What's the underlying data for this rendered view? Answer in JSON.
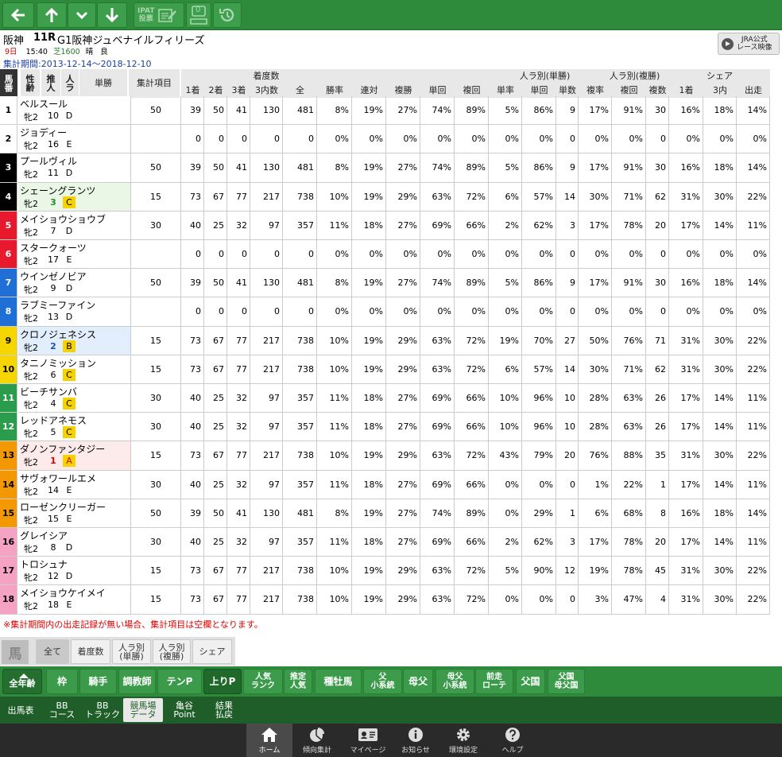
{
  "toolbar": {
    "ipat_label_top": "IPAT",
    "ipat_label_bottom": "投票",
    "memo_badge": "0"
  },
  "race": {
    "venue": "阪神",
    "race_no": "11R",
    "name": "G1阪神ジュベナイルフィリーズ",
    "day": "9日",
    "time": "15:40",
    "course": "芝1600",
    "weather": "晴",
    "going": "良",
    "period": "集計期間:2013-12-14～2018-12-10"
  },
  "jra_button": {
    "line1": "JRA公式",
    "line2": "レース映像"
  },
  "table": {
    "header_top": {
      "chaku": "着度数",
      "ninki_win": "人ラ別(単勝)",
      "ninki_place": "人ラ別(複勝)",
      "share": "シェア"
    },
    "header_left": {
      "umaban_1": "馬",
      "umaban_2": "番",
      "sex_1": "性",
      "sex_2": "齢",
      "est_1": "推",
      "est_2": "人",
      "pop_1": "人",
      "pop_2": "ラ",
      "odds": "単勝",
      "item": "集計項目"
    },
    "columns": [
      "1着",
      "2着",
      "3着",
      "3内数",
      "全",
      "勝率",
      "連対",
      "複勝",
      "単回",
      "複回",
      "単率",
      "単回",
      "単数",
      "複率",
      "複回",
      "複数",
      "1着",
      "3内",
      "出走"
    ],
    "rows": [
      {
        "no": "1",
        "name": "ベルスール",
        "sex": "牝2",
        "pop": "10",
        "mark": "D",
        "item": "50",
        "v": [
          "39",
          "50",
          "41",
          "130",
          "481",
          "8%",
          "19%",
          "27%",
          "74%",
          "89%",
          "5%",
          "86%",
          "9",
          "17%",
          "91%",
          "30",
          "16%",
          "18%",
          "14%"
        ]
      },
      {
        "no": "2",
        "name": "ジョディー",
        "sex": "牝2",
        "pop": "16",
        "mark": "E",
        "item": "",
        "v": [
          "0",
          "0",
          "0",
          "0",
          "0",
          "0%",
          "0%",
          "0%",
          "0%",
          "0%",
          "0%",
          "0%",
          "0",
          "0%",
          "0%",
          "0",
          "0%",
          "0%",
          "0%"
        ]
      },
      {
        "no": "3",
        "name": "プールヴィル",
        "sex": "牝2",
        "pop": "11",
        "mark": "D",
        "item": "50",
        "v": [
          "39",
          "50",
          "41",
          "130",
          "481",
          "8%",
          "19%",
          "27%",
          "74%",
          "89%",
          "5%",
          "86%",
          "9",
          "17%",
          "91%",
          "30",
          "16%",
          "18%",
          "14%"
        ]
      },
      {
        "no": "4",
        "name": "シェーングランツ",
        "sex": "牝2",
        "pop": "3",
        "mark": "C",
        "item": "15",
        "v": [
          "73",
          "67",
          "77",
          "217",
          "738",
          "10%",
          "19%",
          "29%",
          "63%",
          "72%",
          "6%",
          "57%",
          "14",
          "30%",
          "71%",
          "62",
          "31%",
          "30%",
          "22%"
        ]
      },
      {
        "no": "5",
        "name": "メイショウショウブ",
        "sex": "牝2",
        "pop": "7",
        "mark": "D",
        "item": "30",
        "v": [
          "40",
          "25",
          "32",
          "97",
          "357",
          "11%",
          "18%",
          "27%",
          "69%",
          "66%",
          "2%",
          "62%",
          "3",
          "17%",
          "78%",
          "20",
          "17%",
          "14%",
          "11%"
        ]
      },
      {
        "no": "6",
        "name": "スタークォーツ",
        "sex": "牝2",
        "pop": "17",
        "mark": "E",
        "item": "",
        "v": [
          "0",
          "0",
          "0",
          "0",
          "0",
          "0%",
          "0%",
          "0%",
          "0%",
          "0%",
          "0%",
          "0%",
          "0",
          "0%",
          "0%",
          "0",
          "0%",
          "0%",
          "0%"
        ]
      },
      {
        "no": "7",
        "name": "ウインゼノビア",
        "sex": "牝2",
        "pop": "9",
        "mark": "D",
        "item": "50",
        "v": [
          "39",
          "50",
          "41",
          "130",
          "481",
          "8%",
          "19%",
          "27%",
          "74%",
          "89%",
          "5%",
          "86%",
          "9",
          "17%",
          "91%",
          "30",
          "16%",
          "18%",
          "14%"
        ]
      },
      {
        "no": "8",
        "name": "ラブミーファイン",
        "sex": "牝2",
        "pop": "13",
        "mark": "D",
        "item": "",
        "v": [
          "0",
          "0",
          "0",
          "0",
          "0",
          "0%",
          "0%",
          "0%",
          "0%",
          "0%",
          "0%",
          "0%",
          "0",
          "0%",
          "0%",
          "0",
          "0%",
          "0%",
          "0%"
        ]
      },
      {
        "no": "9",
        "name": "クロノジェネシス",
        "sex": "牝2",
        "pop": "2",
        "mark": "B",
        "item": "15",
        "v": [
          "73",
          "67",
          "77",
          "217",
          "738",
          "10%",
          "19%",
          "29%",
          "63%",
          "72%",
          "19%",
          "70%",
          "27",
          "50%",
          "76%",
          "71",
          "31%",
          "30%",
          "22%"
        ]
      },
      {
        "no": "10",
        "name": "タニノミッション",
        "sex": "牝2",
        "pop": "6",
        "mark": "C",
        "item": "15",
        "v": [
          "73",
          "67",
          "77",
          "217",
          "738",
          "10%",
          "19%",
          "29%",
          "63%",
          "72%",
          "6%",
          "57%",
          "14",
          "30%",
          "71%",
          "62",
          "31%",
          "30%",
          "22%"
        ]
      },
      {
        "no": "11",
        "name": "ビーチサンバ",
        "sex": "牝2",
        "pop": "4",
        "mark": "C",
        "item": "30",
        "v": [
          "40",
          "25",
          "32",
          "97",
          "357",
          "11%",
          "18%",
          "27%",
          "69%",
          "66%",
          "10%",
          "96%",
          "10",
          "28%",
          "63%",
          "26",
          "17%",
          "14%",
          "11%"
        ]
      },
      {
        "no": "12",
        "name": "レッドアネモス",
        "sex": "牝2",
        "pop": "5",
        "mark": "C",
        "item": "30",
        "v": [
          "40",
          "25",
          "32",
          "97",
          "357",
          "11%",
          "18%",
          "27%",
          "69%",
          "66%",
          "10%",
          "96%",
          "10",
          "28%",
          "63%",
          "26",
          "17%",
          "14%",
          "11%"
        ]
      },
      {
        "no": "13",
        "name": "ダノンファンタジー",
        "sex": "牝2",
        "pop": "1",
        "mark": "A",
        "item": "15",
        "v": [
          "73",
          "67",
          "77",
          "217",
          "738",
          "10%",
          "19%",
          "29%",
          "63%",
          "72%",
          "43%",
          "79%",
          "20",
          "76%",
          "88%",
          "35",
          "31%",
          "30%",
          "22%"
        ]
      },
      {
        "no": "14",
        "name": "サヴォワールエメ",
        "sex": "牝2",
        "pop": "14",
        "mark": "E",
        "item": "30",
        "v": [
          "40",
          "25",
          "32",
          "97",
          "357",
          "11%",
          "18%",
          "27%",
          "69%",
          "66%",
          "0%",
          "0%",
          "0",
          "1%",
          "22%",
          "1",
          "17%",
          "14%",
          "11%"
        ]
      },
      {
        "no": "15",
        "name": "ローゼンクリーガー",
        "sex": "牝2",
        "pop": "15",
        "mark": "E",
        "item": "50",
        "v": [
          "39",
          "50",
          "41",
          "130",
          "481",
          "8%",
          "19%",
          "27%",
          "74%",
          "89%",
          "0%",
          "29%",
          "1",
          "6%",
          "68%",
          "8",
          "16%",
          "18%",
          "14%"
        ]
      },
      {
        "no": "16",
        "name": "グレイシア",
        "sex": "牝2",
        "pop": "8",
        "mark": "D",
        "item": "30",
        "v": [
          "40",
          "25",
          "32",
          "97",
          "357",
          "11%",
          "18%",
          "27%",
          "69%",
          "66%",
          "2%",
          "62%",
          "3",
          "17%",
          "78%",
          "20",
          "17%",
          "14%",
          "11%"
        ]
      },
      {
        "no": "17",
        "name": "トロシュナ",
        "sex": "牝2",
        "pop": "12",
        "mark": "D",
        "item": "15",
        "v": [
          "73",
          "67",
          "77",
          "217",
          "738",
          "10%",
          "19%",
          "29%",
          "63%",
          "72%",
          "5%",
          "90%",
          "12",
          "19%",
          "78%",
          "45",
          "31%",
          "30%",
          "22%"
        ]
      },
      {
        "no": "18",
        "name": "メイショウケイメイ",
        "sex": "牝2",
        "pop": "18",
        "mark": "E",
        "item": "15",
        "v": [
          "73",
          "67",
          "77",
          "217",
          "738",
          "10%",
          "19%",
          "29%",
          "63%",
          "72%",
          "0%",
          "0%",
          "0",
          "3%",
          "47%",
          "4",
          "31%",
          "30%",
          "22%"
        ]
      }
    ]
  },
  "note": "※集計期間内の出走記録が無い場合、集計項目は空欄となります。",
  "section_tabs": {
    "uma": "馬",
    "items": [
      {
        "l1": "全て",
        "l2": ""
      },
      {
        "l1": "着度数",
        "l2": ""
      },
      {
        "l1": "人ラ別",
        "l2": "(単勝)"
      },
      {
        "l1": "人ラ別",
        "l2": "(複勝)"
      },
      {
        "l1": "シェア",
        "l2": ""
      }
    ]
  },
  "category_bar": {
    "all_year": "全年齢",
    "items": [
      {
        "l1": "枠",
        "l2": ""
      },
      {
        "l1": "騎手",
        "l2": ""
      },
      {
        "l1": "調教師",
        "l2": ""
      },
      {
        "l1": "テンP",
        "l2": ""
      },
      {
        "l1": "上りP",
        "l2": ""
      },
      {
        "l1": "人気",
        "l2": "ランク"
      },
      {
        "l1": "推定",
        "l2": "人気"
      },
      {
        "l1": "種牡馬",
        "l2": ""
      },
      {
        "l1": "父",
        "l2": "小系統"
      },
      {
        "l1": "母父",
        "l2": ""
      },
      {
        "l1": "母父",
        "l2": "小系統"
      },
      {
        "l1": "前走",
        "l2": "ローテ"
      },
      {
        "l1": "父国",
        "l2": ""
      },
      {
        "l1": "父国",
        "l2": "母父国"
      }
    ]
  },
  "sub_bar": {
    "items": [
      {
        "l1": "出馬表",
        "l2": ""
      },
      {
        "l1": "BB",
        "l2": "コース"
      },
      {
        "l1": "BB",
        "l2": "トラック"
      },
      {
        "l1": "競馬場",
        "l2": "データ"
      },
      {
        "l1": "亀谷",
        "l2": "Point"
      },
      {
        "l1": "結果",
        "l2": "払戻"
      }
    ]
  },
  "bottom_nav": {
    "items": [
      {
        "label": "ホーム",
        "icon": "home-icon"
      },
      {
        "label": "傾向集計",
        "icon": "pie-chart-icon"
      },
      {
        "label": "マイページ",
        "icon": "id-card-icon"
      },
      {
        "label": "お知らせ",
        "icon": "info-icon"
      },
      {
        "label": "環境設定",
        "icon": "gear-icon"
      },
      {
        "label": "ヘルプ",
        "icon": "help-icon"
      }
    ]
  },
  "colors": {
    "frame_1": "#ffffff",
    "frame_2": "#000000",
    "frame_3": "#e8192c",
    "frame_4": "#1f6fd6",
    "frame_5": "#f6d600",
    "frame_6": "#2b9b4c",
    "frame_7": "#f39800",
    "frame_8": "#f6a3c3",
    "mark_bg": "#f5d200",
    "toolbar": "#2e8b3c"
  }
}
